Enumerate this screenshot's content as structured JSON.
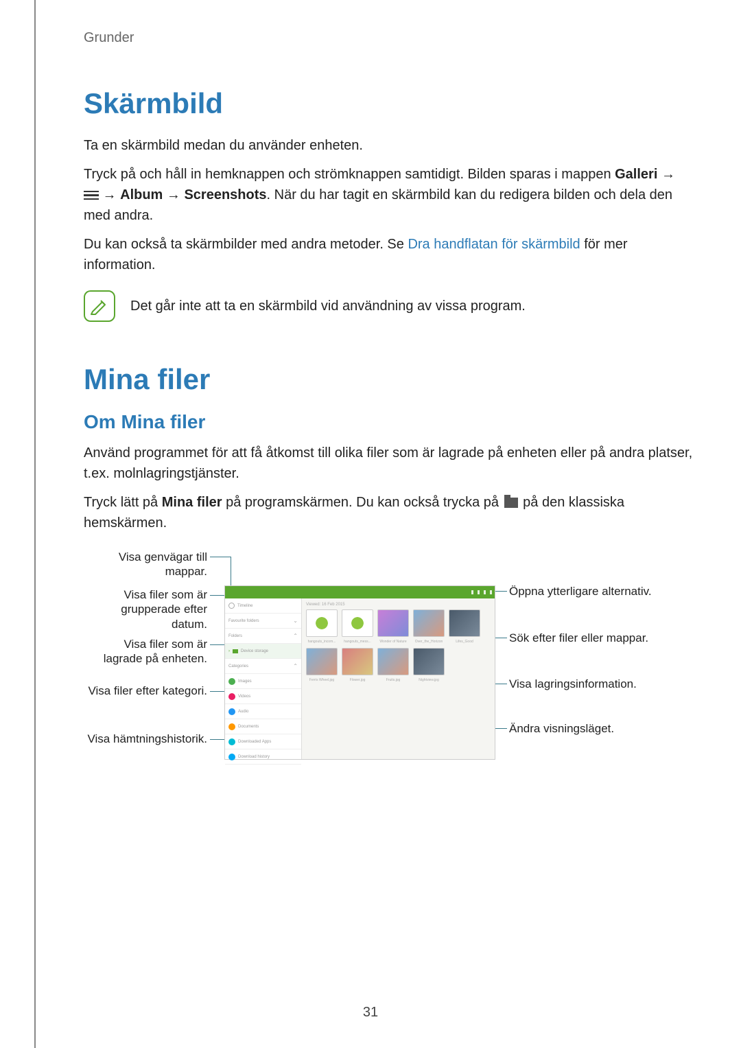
{
  "breadcrumb": "Grunder",
  "page_number": "31",
  "section1": {
    "title": "Skärmbild",
    "p1": "Ta en skärmbild medan du använder enheten.",
    "p2_a": "Tryck på och håll in hemknappen och strömknappen samtidigt. Bilden sparas i mappen ",
    "p2_b": "Galleri",
    "p2_c": " → ",
    "p2_d": " → ",
    "p2_e": "Album",
    "p2_f": " → ",
    "p2_g": "Screenshots",
    "p2_h": ". När du har tagit en skärmbild kan du redigera bilden och dela den med andra.",
    "p3_a": "Du kan också ta skärmbilder med andra metoder. Se ",
    "p3_link": "Dra handflatan för skärmbild",
    "p3_b": " för mer information.",
    "note": "Det går inte att ta en skärmbild vid användning av vissa program."
  },
  "section2": {
    "title": "Mina filer",
    "subtitle": "Om Mina filer",
    "p1": "Använd programmet för att få åtkomst till olika filer som är lagrade på enheten eller på andra platser, t.ex. molnlagringstjänster.",
    "p2_a": "Tryck lätt på ",
    "p2_b": "Mina filer",
    "p2_c": " på programskärmen. Du kan också trycka på ",
    "p2_d": " på den klassiska hemskärmen."
  },
  "callouts": {
    "left": [
      "Visa genvägar till mappar.",
      "Visa filer som är grupperade efter datum.",
      "Visa filer som är lagrade på enheten.",
      "Visa filer efter kategori.",
      "Visa hämtningshistorik."
    ],
    "right": [
      "Öppna ytterligare alternativ.",
      "Sök efter filer eller mappar.",
      "Visa lagringsinformation.",
      "Ändra visningsläget."
    ]
  },
  "diagram_icons": {
    "hamburger": "hamburger-icon",
    "folder": "folder-icon",
    "note": "note-icon"
  },
  "colors": {
    "heading": "#2c7bb6",
    "link": "#2c7bb6",
    "note_border": "#5aa62e",
    "callout_line": "#3a7a8a"
  }
}
